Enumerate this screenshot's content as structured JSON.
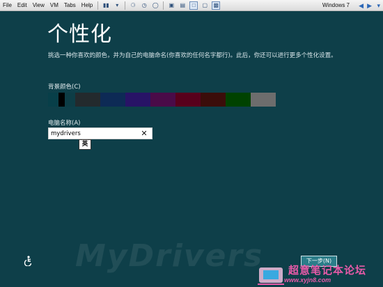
{
  "vm_toolbar": {
    "menus": [
      "File",
      "Edit",
      "View",
      "VM",
      "Tabs",
      "Help"
    ],
    "tab_label": "Windows 7"
  },
  "setup": {
    "title": "个性化",
    "description": "挑选一种你喜欢的颜色，并为自己的电脑命名(你喜欢的任何名字都行)。此后，你还可以进行更多个性化设置。",
    "background_color_label": "背景颜色(C)",
    "background_colors": [
      "#083f49",
      "#000000",
      "#0d3d46",
      "#232a2d",
      "#0d2a55",
      "#281366",
      "#4a0b48",
      "#58001c",
      "#3b0d0a",
      "#004200",
      "#6d6d6d"
    ],
    "selected_color_index": 1,
    "pc_name_label": "电脑名称(A)",
    "pc_name_value": "mydrivers",
    "ime_indicator": "英",
    "next_button": "下一步(N)"
  },
  "watermark": {
    "main": "MyDrivers",
    "cn": "超意笔记本论坛",
    "url": "www.xyjn8.com"
  },
  "icons": {
    "accessibility": "ease-of-access-icon",
    "clear": "clear-x-icon"
  }
}
